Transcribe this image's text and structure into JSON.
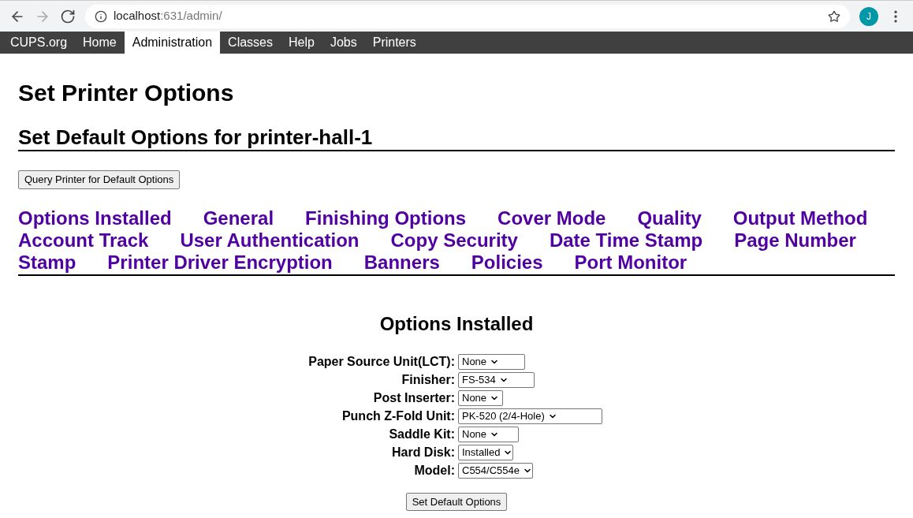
{
  "browser": {
    "url_host": "localhost",
    "url_path": ":631/admin/",
    "profile_initial": "J"
  },
  "nav": [
    {
      "label": "CUPS.org",
      "selected": false
    },
    {
      "label": "Home",
      "selected": false
    },
    {
      "label": "Administration",
      "selected": true
    },
    {
      "label": "Classes",
      "selected": false
    },
    {
      "label": "Help",
      "selected": false
    },
    {
      "label": "Jobs",
      "selected": false
    },
    {
      "label": "Printers",
      "selected": false
    }
  ],
  "title": "Set Printer Options",
  "subtitle": "Set Default Options for printer-hall-1",
  "query_button": "Query Printer for Default Options",
  "sections": [
    "Options Installed",
    "General",
    "Finishing Options",
    "Cover Mode",
    "Quality",
    "Output Method",
    "Account Track",
    "User Authentication",
    "Copy Security",
    "Date Time Stamp",
    "Page Number",
    "Stamp",
    "Printer Driver Encryption",
    "Banners",
    "Policies",
    "Port Monitor"
  ],
  "form_title": "Options Installed",
  "options": [
    {
      "label": "Paper Source Unit(LCT):",
      "value": "None"
    },
    {
      "label": "Finisher:",
      "value": "FS-534"
    },
    {
      "label": "Post Inserter:",
      "value": "None"
    },
    {
      "label": "Punch Z-Fold Unit:",
      "value": "PK-520 (2/4-Hole)"
    },
    {
      "label": "Saddle Kit:",
      "value": "None"
    },
    {
      "label": "Hard Disk:",
      "value": "Installed"
    },
    {
      "label": "Model:",
      "value": "C554/C554e"
    }
  ],
  "submit_button": "Set Default Options"
}
